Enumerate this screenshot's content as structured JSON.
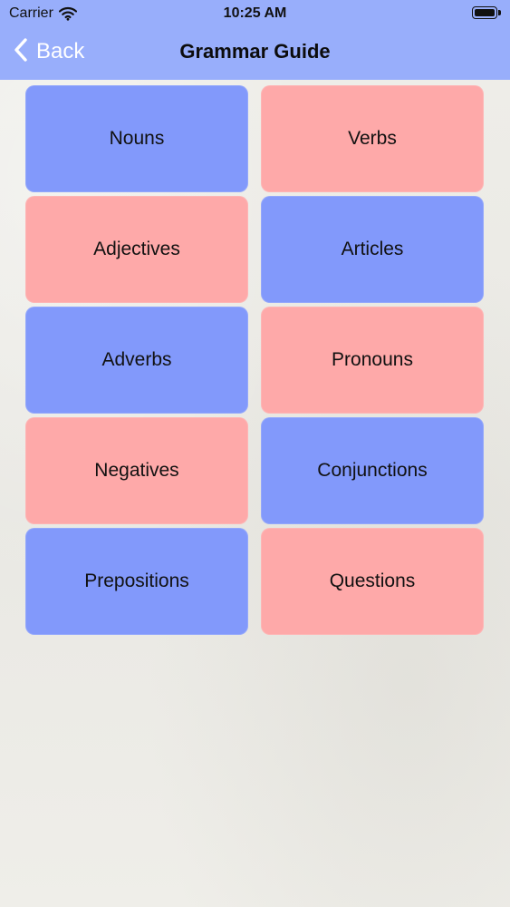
{
  "status_bar": {
    "carrier": "Carrier",
    "time": "10:25 AM",
    "icons": [
      "wifi-icon",
      "battery-icon"
    ]
  },
  "nav": {
    "back_label": "Back",
    "title": "Grammar Guide",
    "back_icon": "chevron-left-icon"
  },
  "colors": {
    "nav_background": "#98aefb",
    "tile_blue": "#8299fb",
    "tile_pink": "#fea9a9",
    "back_text": "#ffffff"
  },
  "topics": [
    {
      "label": "Nouns",
      "color": "blue"
    },
    {
      "label": "Verbs",
      "color": "pink"
    },
    {
      "label": "Adjectives",
      "color": "pink"
    },
    {
      "label": "Articles",
      "color": "blue"
    },
    {
      "label": "Adverbs",
      "color": "blue"
    },
    {
      "label": "Pronouns",
      "color": "pink"
    },
    {
      "label": "Negatives",
      "color": "pink"
    },
    {
      "label": "Conjunctions",
      "color": "blue"
    },
    {
      "label": "Prepositions",
      "color": "blue"
    },
    {
      "label": "Questions",
      "color": "pink"
    }
  ]
}
